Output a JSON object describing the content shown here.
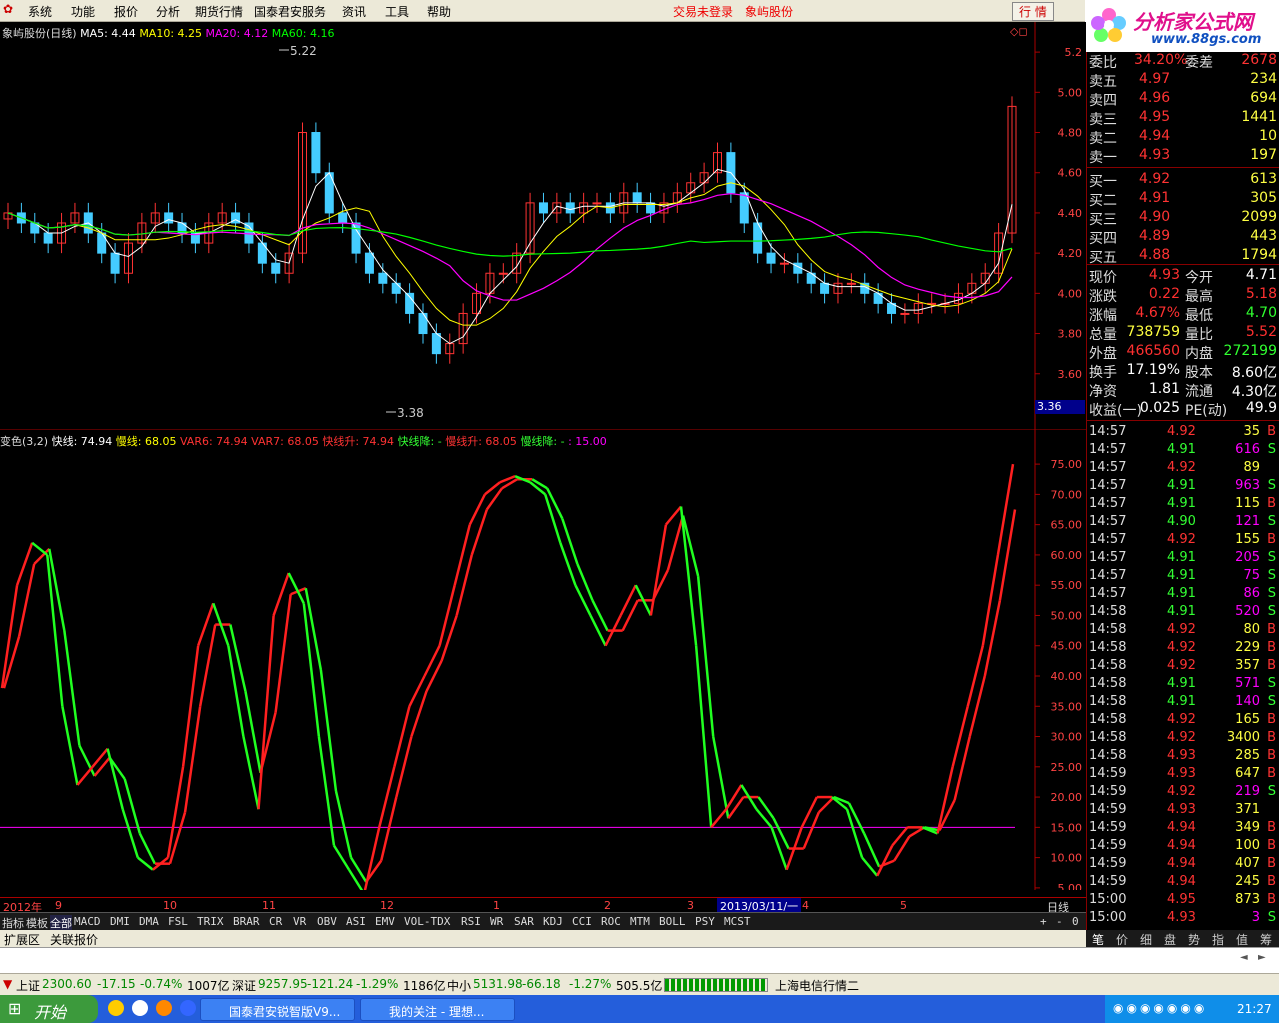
{
  "menu": {
    "items": [
      "系统",
      "功能",
      "报价",
      "分析",
      "期货行情",
      "国泰君安服务",
      "资讯",
      "工具",
      "帮助"
    ],
    "trade_status": "交易未登录",
    "stock_name": "象屿股份",
    "quote_button": "行 情",
    "logo_text": "分析家公式网",
    "logo_url": "www.88gs.com"
  },
  "price_chart": {
    "legend_title": "象屿股份(日线)",
    "ma5": "MA5: 4.44",
    "ma10": "MA10: 4.25",
    "ma20": "MA20: 4.12",
    "ma60": "MA60: 4.16",
    "high_label": "5.22",
    "low_label": "3.38",
    "current_marker": "3.36",
    "y_ticks": [
      "5.2",
      "5.00",
      "4.80",
      "4.60",
      "4.40",
      "4.20",
      "4.00",
      "3.80",
      "3.60"
    ]
  },
  "indicator": {
    "name": "变色(3,2)",
    "fast": "快线: 74.94",
    "slow": "慢线: 68.05",
    "var6": "VAR6: 74.94",
    "var7": "VAR7: 68.05",
    "fast_up": "快线升: 74.94",
    "fast_down": "快线降: -",
    "slow_up": "慢线升: 68.05",
    "slow_down": "慢线降: -",
    "level": ": 15.00",
    "y_ticks": [
      "75.00",
      "70.00",
      "65.00",
      "60.00",
      "55.00",
      "50.00",
      "45.00",
      "40.00",
      "35.00",
      "30.00",
      "25.00",
      "20.00",
      "15.00",
      "10.00",
      "5.00"
    ]
  },
  "x_axis": {
    "year": "2012年",
    "months": [
      "9",
      "10",
      "11",
      "12",
      "1",
      "2",
      "3",
      "4",
      "5"
    ],
    "date_cursor": "2013/03/11/一",
    "period": "日线"
  },
  "tabs": [
    "指标",
    "模板",
    "全部",
    "MACD",
    "DMI",
    "DMA",
    "FSL",
    "TRIX",
    "BRAR",
    "CR",
    "VR",
    "OBV",
    "ASI",
    "EMV",
    "VOL-TDX",
    "RSI",
    "WR",
    "SAR",
    "KDJ",
    "CCI",
    "ROC",
    "MTM",
    "BOLL",
    "PSY",
    "MCST"
  ],
  "tab_controls": [
    "+",
    "-",
    "0"
  ],
  "ext_tabs": [
    "扩展区",
    "关联报价"
  ],
  "quote_tabs": [
    "笔",
    "价",
    "细",
    "盘",
    "势",
    "指",
    "值",
    "筹"
  ],
  "quote": {
    "wei_bi_label": "委比",
    "wei_bi": "34.20%",
    "wei_cha_label": "委差",
    "wei_cha": "2678",
    "sell": [
      {
        "label": "卖五",
        "price": "4.97",
        "vol": "234"
      },
      {
        "label": "卖四",
        "price": "4.96",
        "vol": "694"
      },
      {
        "label": "卖三",
        "price": "4.95",
        "vol": "1441"
      },
      {
        "label": "卖二",
        "price": "4.94",
        "vol": "10"
      },
      {
        "label": "卖一",
        "price": "4.93",
        "vol": "197"
      }
    ],
    "buy": [
      {
        "label": "买一",
        "price": "4.92",
        "vol": "613"
      },
      {
        "label": "买二",
        "price": "4.91",
        "vol": "305"
      },
      {
        "label": "买三",
        "price": "4.90",
        "vol": "2099"
      },
      {
        "label": "买四",
        "price": "4.89",
        "vol": "443"
      },
      {
        "label": "买五",
        "price": "4.88",
        "vol": "1794"
      }
    ],
    "stats": [
      {
        "l1": "现价",
        "v1": "4.93",
        "l2": "今开",
        "v2": "4.71",
        "c1": "#ff3030",
        "c2": "#ffffff"
      },
      {
        "l1": "涨跌",
        "v1": "0.22",
        "l2": "最高",
        "v2": "5.18",
        "c1": "#ff3030",
        "c2": "#ff3030"
      },
      {
        "l1": "涨幅",
        "v1": "4.67%",
        "l2": "最低",
        "v2": "4.70",
        "c1": "#ff3030",
        "c2": "#30ff30"
      },
      {
        "l1": "总量",
        "v1": "738759",
        "l2": "量比",
        "v2": "5.52",
        "c1": "#ffff40",
        "c2": "#ff3030"
      },
      {
        "l1": "外盘",
        "v1": "466560",
        "l2": "内盘",
        "v2": "272199",
        "c1": "#ff3030",
        "c2": "#30ff30"
      },
      {
        "l1": "换手",
        "v1": "17.19%",
        "l2": "股本",
        "v2": "8.60亿",
        "c1": "#ffffff",
        "c2": "#ffffff"
      },
      {
        "l1": "净资",
        "v1": "1.81",
        "l2": "流通",
        "v2": "4.30亿",
        "c1": "#ffffff",
        "c2": "#ffffff"
      },
      {
        "l1": "收益(一)",
        "v1": "0.025",
        "l2": "PE(动)",
        "v2": "49.9",
        "c1": "#ffffff",
        "c2": "#ffffff"
      }
    ]
  },
  "ticks": [
    {
      "t": "14:57",
      "p": "4.92",
      "v": "35",
      "d": "B"
    },
    {
      "t": "14:57",
      "p": "4.91",
      "v": "616",
      "d": "S"
    },
    {
      "t": "14:57",
      "p": "4.92",
      "v": "89",
      "d": ""
    },
    {
      "t": "14:57",
      "p": "4.91",
      "v": "963",
      "d": "S"
    },
    {
      "t": "14:57",
      "p": "4.91",
      "v": "115",
      "d": "B"
    },
    {
      "t": "14:57",
      "p": "4.90",
      "v": "121",
      "d": "S"
    },
    {
      "t": "14:57",
      "p": "4.92",
      "v": "155",
      "d": "B"
    },
    {
      "t": "14:57",
      "p": "4.91",
      "v": "205",
      "d": "S"
    },
    {
      "t": "14:57",
      "p": "4.91",
      "v": "75",
      "d": "S"
    },
    {
      "t": "14:57",
      "p": "4.91",
      "v": "86",
      "d": "S"
    },
    {
      "t": "14:58",
      "p": "4.91",
      "v": "520",
      "d": "S"
    },
    {
      "t": "14:58",
      "p": "4.92",
      "v": "80",
      "d": "B"
    },
    {
      "t": "14:58",
      "p": "4.92",
      "v": "229",
      "d": "B"
    },
    {
      "t": "14:58",
      "p": "4.92",
      "v": "357",
      "d": "B"
    },
    {
      "t": "14:58",
      "p": "4.91",
      "v": "571",
      "d": "S"
    },
    {
      "t": "14:58",
      "p": "4.91",
      "v": "140",
      "d": "S"
    },
    {
      "t": "14:58",
      "p": "4.92",
      "v": "165",
      "d": "B"
    },
    {
      "t": "14:58",
      "p": "4.92",
      "v": "3400",
      "d": "B"
    },
    {
      "t": "14:58",
      "p": "4.93",
      "v": "285",
      "d": "B"
    },
    {
      "t": "14:59",
      "p": "4.93",
      "v": "647",
      "d": "B"
    },
    {
      "t": "14:59",
      "p": "4.92",
      "v": "219",
      "d": "S"
    },
    {
      "t": "14:59",
      "p": "4.93",
      "v": "371",
      "d": ""
    },
    {
      "t": "14:59",
      "p": "4.94",
      "v": "349",
      "d": "B"
    },
    {
      "t": "14:59",
      "p": "4.94",
      "v": "100",
      "d": "B"
    },
    {
      "t": "14:59",
      "p": "4.94",
      "v": "407",
      "d": "B"
    },
    {
      "t": "14:59",
      "p": "4.94",
      "v": "245",
      "d": "B"
    },
    {
      "t": "15:00",
      "p": "4.95",
      "v": "873",
      "d": "B"
    },
    {
      "t": "15:00",
      "p": "4.93",
      "v": "3",
      "d": "S"
    }
  ],
  "status": {
    "sh_label": "上证",
    "sh_value": "2300.60",
    "sh_change": "-17.15",
    "sh_pct": "-0.74%",
    "sh_amount": "1007亿",
    "sz_label": "深证",
    "sz_value": "9257.95",
    "sz_change": "-121.24",
    "sz_pct": "-1.29%",
    "sz_amount": "1186亿",
    "zx_label": "中小",
    "zx_value": "5131.98",
    "zx_change": "-66.18",
    "zx_pct": "-1.27%",
    "zx_amount": "505.5亿",
    "server": "上海电信行情二"
  },
  "taskbar": {
    "start": "开始",
    "task1": "国泰君安锐智版V9...",
    "task2": "我的关注 - 理想...",
    "clock": "21:27"
  },
  "chart_data": [
    {
      "type": "candlestick",
      "title": "象屿股份(日线)",
      "ylim": [
        3.36,
        5.3
      ],
      "series": [
        {
          "name": "MA5",
          "color": "#ffffff",
          "last": 4.44
        },
        {
          "name": "MA10",
          "color": "#ffff00",
          "last": 4.25
        },
        {
          "name": "MA20",
          "color": "#ff00ff",
          "last": 4.12
        },
        {
          "name": "MA60",
          "color": "#00ff00",
          "last": 4.16
        }
      ],
      "annotations": [
        {
          "label": "5.22",
          "value": 5.22
        },
        {
          "label": "3.38",
          "value": 3.38
        }
      ],
      "close": [
        4.4,
        4.35,
        4.3,
        4.25,
        4.35,
        4.4,
        4.3,
        4.2,
        4.1,
        4.25,
        4.35,
        4.4,
        4.35,
        4.3,
        4.25,
        4.35,
        4.4,
        4.35,
        4.25,
        4.15,
        4.1,
        4.2,
        4.8,
        4.6,
        4.4,
        4.35,
        4.2,
        4.1,
        4.05,
        4.0,
        3.9,
        3.8,
        3.7,
        3.75,
        3.9,
        4.0,
        4.1,
        4.1,
        4.2,
        4.45,
        4.4,
        4.45,
        4.4,
        4.45,
        4.45,
        4.4,
        4.5,
        4.45,
        4.4,
        4.45,
        4.5,
        4.55,
        4.6,
        4.7,
        4.5,
        4.35,
        4.2,
        4.15,
        4.15,
        4.1,
        4.05,
        4.0,
        4.05,
        4.05,
        4.0,
        3.95,
        3.9,
        3.9,
        3.95,
        3.95,
        3.95,
        4.0,
        4.05,
        4.1,
        4.3,
        4.93
      ]
    },
    {
      "type": "line",
      "title": "变色(3,2)",
      "ylim": [
        3,
        77
      ],
      "series": [
        {
          "name": "快线",
          "last": 74.94,
          "values": [
            38,
            55,
            62,
            60,
            35,
            22,
            25,
            28,
            18,
            10,
            8,
            10,
            25,
            45,
            52,
            45,
            30,
            18,
            50,
            57,
            52,
            30,
            12,
            8,
            4,
            15,
            25,
            35,
            40,
            45,
            55,
            65,
            70,
            72,
            73,
            72,
            70,
            62,
            55,
            50,
            45,
            50,
            55,
            50,
            65,
            68,
            45,
            15,
            18,
            22,
            18,
            15,
            8,
            15,
            20,
            20,
            18,
            10,
            7,
            12,
            15,
            15,
            14,
            25,
            35,
            45,
            60,
            75
          ]
        },
        {
          "name": "慢线",
          "last": 68.05
        },
        {
          "name": "",
          "value": 15,
          "color": "#ff00ff"
        }
      ]
    }
  ]
}
